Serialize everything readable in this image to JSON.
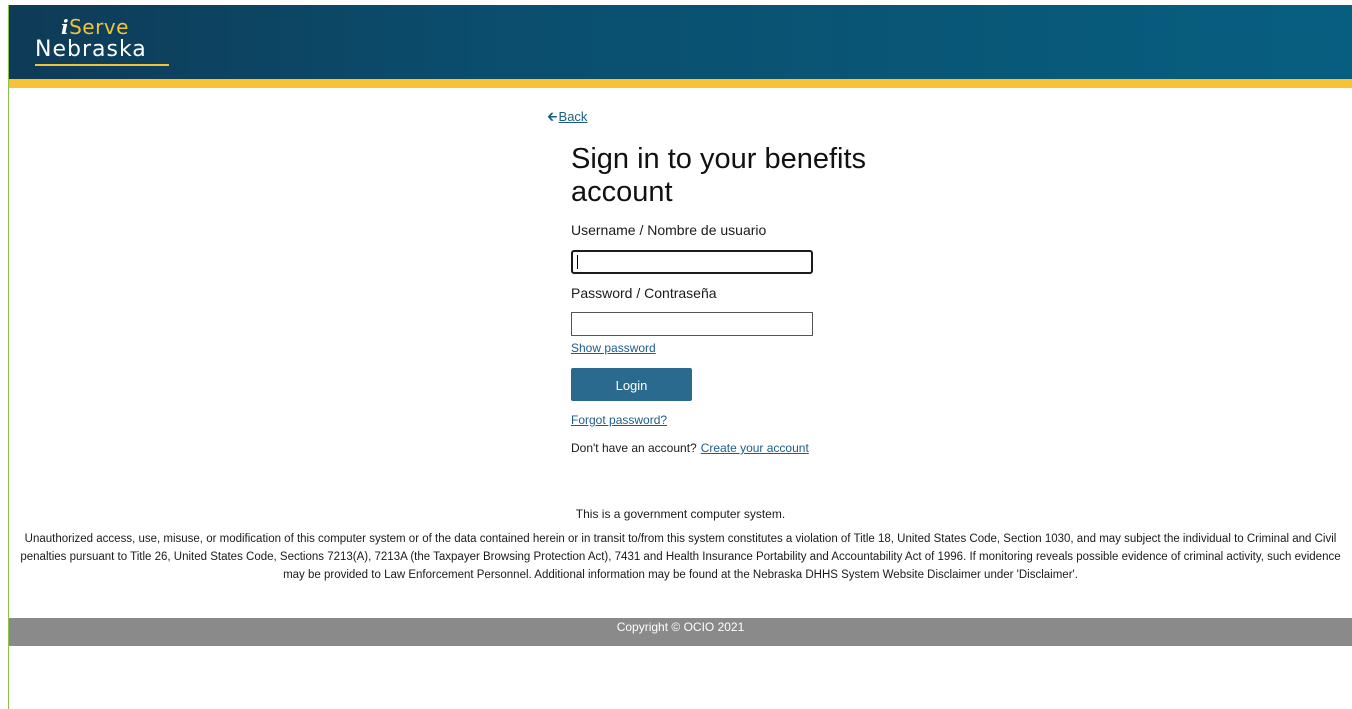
{
  "header": {
    "logo_prefix": "i",
    "logo_top": "Serve",
    "logo_bottom": "Nebraska",
    "brand_dark": "#0e3b57",
    "brand_light": "#075f80",
    "accent": "#f5c335"
  },
  "nav": {
    "back_icon": "arrow-left-icon",
    "back_label": "Back"
  },
  "form": {
    "title": "Sign in to your benefits account",
    "username_label": "Username / Nombre de usuario",
    "username_value": "",
    "password_label": "Password / Contraseña",
    "password_value": "",
    "show_password_label": "Show password",
    "login_label": "Login",
    "button_color": "#2a6a8e",
    "forgot_label": "Forgot password?",
    "no_account_text": "Don't have an account?",
    "create_account_label": "Create your account"
  },
  "notice": {
    "government": "This is a government computer system.",
    "disclaimer": "Unauthorized access, use, misuse, or modification of this computer system or of the data contained herein or in transit to/from this system constitutes a violation of Title 18, United States Code, Section 1030, and may subject the individual to Criminal and Civil penalties pursuant to Title 26, United States Code, Sections 7213(A), 7213A (the Taxpayer Browsing Protection Act), 7431 and Health Insurance Portability and Accountability Act of 1996. If monitoring reveals possible evidence of criminal activity, such evidence may be provided to Law Enforcement Personnel. Additional information may be found at the Nebraska DHHS System Website Disclaimer under 'Disclaimer'."
  },
  "footer": {
    "copyright": "Copyright © OCIO 2021",
    "color": "#8a8a8a"
  }
}
